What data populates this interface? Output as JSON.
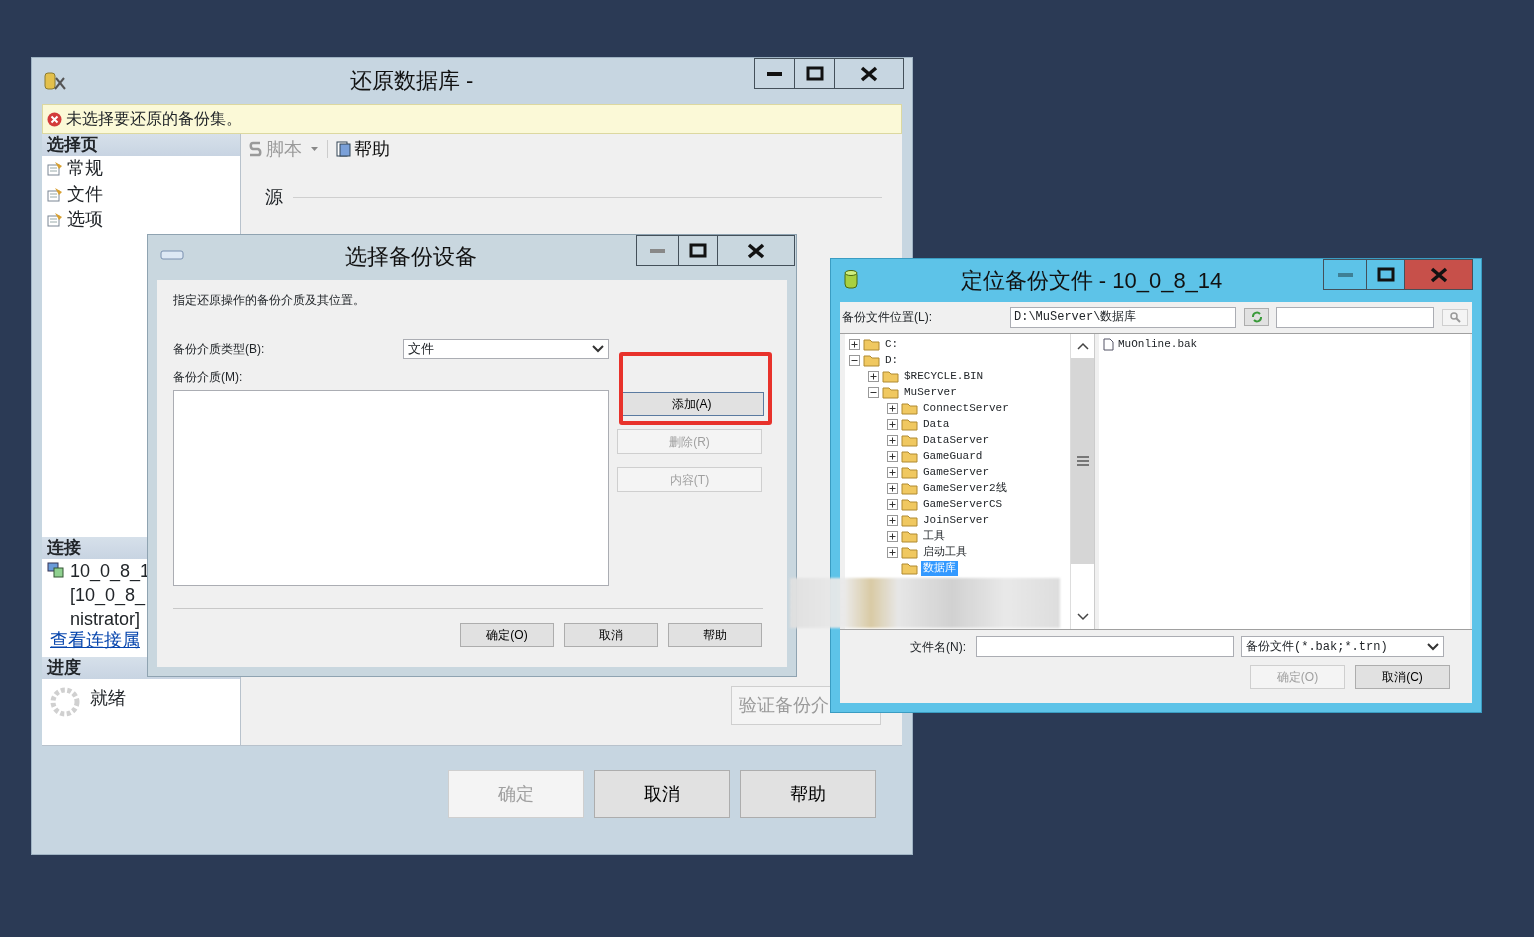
{
  "main_window": {
    "title": "还原数据库 -",
    "error": "未选择要还原的备份集。",
    "select_page": {
      "header": "选择页",
      "items": [
        {
          "label": "常规"
        },
        {
          "label": "文件"
        },
        {
          "label": "选项"
        }
      ]
    },
    "toolbar": [
      {
        "label": "脚本",
        "kind": "dropdown",
        "disabled": true
      },
      {
        "label": "帮助",
        "kind": "button",
        "disabled": false
      }
    ],
    "source_heading": "源",
    "connection": {
      "header": "连接",
      "lines": [
        "10_0_8_1",
        "[10_0_8_",
        "nistrator]"
      ],
      "link": "查看连接属"
    },
    "progress": {
      "header": "进度",
      "status": "就绪"
    },
    "verify_button": "验证备份介",
    "buttons": [
      {
        "label": "确定",
        "disabled": true
      },
      {
        "label": "取消",
        "disabled": false
      },
      {
        "label": "帮助",
        "disabled": false
      }
    ]
  },
  "device_dialog": {
    "title": "选择备份设备",
    "instruction": "指定还原操作的备份介质及其位置。",
    "media_type_label": "备份介质类型(B):",
    "media_type_value": "文件",
    "media_label": "备份介质(M):",
    "side_buttons": [
      {
        "label": "添加(A)",
        "disabled": false,
        "highlighted": true
      },
      {
        "label": "删除(R)",
        "disabled": true,
        "highlighted": false
      },
      {
        "label": "内容(T)",
        "disabled": true,
        "highlighted": false
      }
    ],
    "buttons": [
      {
        "label": "确定(O)",
        "disabled": false
      },
      {
        "label": "取消",
        "disabled": false
      },
      {
        "label": "帮助",
        "disabled": false
      }
    ]
  },
  "locate_dialog": {
    "title": "定位备份文件 - 10_0_8_14",
    "location_label": "备份文件位置(L):",
    "location_value": "D:\\MuServer\\数据库",
    "tree": [
      {
        "label": "C:",
        "expanded": false,
        "selected": false
      },
      {
        "label": "D:",
        "expanded": true,
        "selected": false,
        "children": [
          {
            "label": "$RECYCLE.BIN",
            "expanded": false,
            "selected": false
          },
          {
            "label": "MuServer",
            "expanded": true,
            "selected": false,
            "children": [
              {
                "label": "ConnectServer",
                "expanded": false,
                "selected": false
              },
              {
                "label": "Data",
                "expanded": false,
                "selected": false
              },
              {
                "label": "DataServer",
                "expanded": false,
                "selected": false
              },
              {
                "label": "GameGuard",
                "expanded": false,
                "selected": false
              },
              {
                "label": "GameServer",
                "expanded": false,
                "selected": false
              },
              {
                "label": "GameServer2线",
                "expanded": false,
                "selected": false
              },
              {
                "label": "GameServerCS",
                "expanded": false,
                "selected": false
              },
              {
                "label": "JoinServer",
                "expanded": false,
                "selected": false
              },
              {
                "label": "工具",
                "expanded": false,
                "selected": false
              },
              {
                "label": "启动工具",
                "expanded": false,
                "selected": false
              },
              {
                "label": "数据库",
                "selected": true
              }
            ]
          }
        ]
      }
    ],
    "files": [
      {
        "name": "MuOnline.bak"
      }
    ],
    "filename_label": "文件名(N):",
    "filter_value": "备份文件(*.bak;*.trn)",
    "buttons": [
      {
        "label": "确定(O)",
        "disabled": true
      },
      {
        "label": "取消(C)",
        "disabled": false
      }
    ]
  }
}
